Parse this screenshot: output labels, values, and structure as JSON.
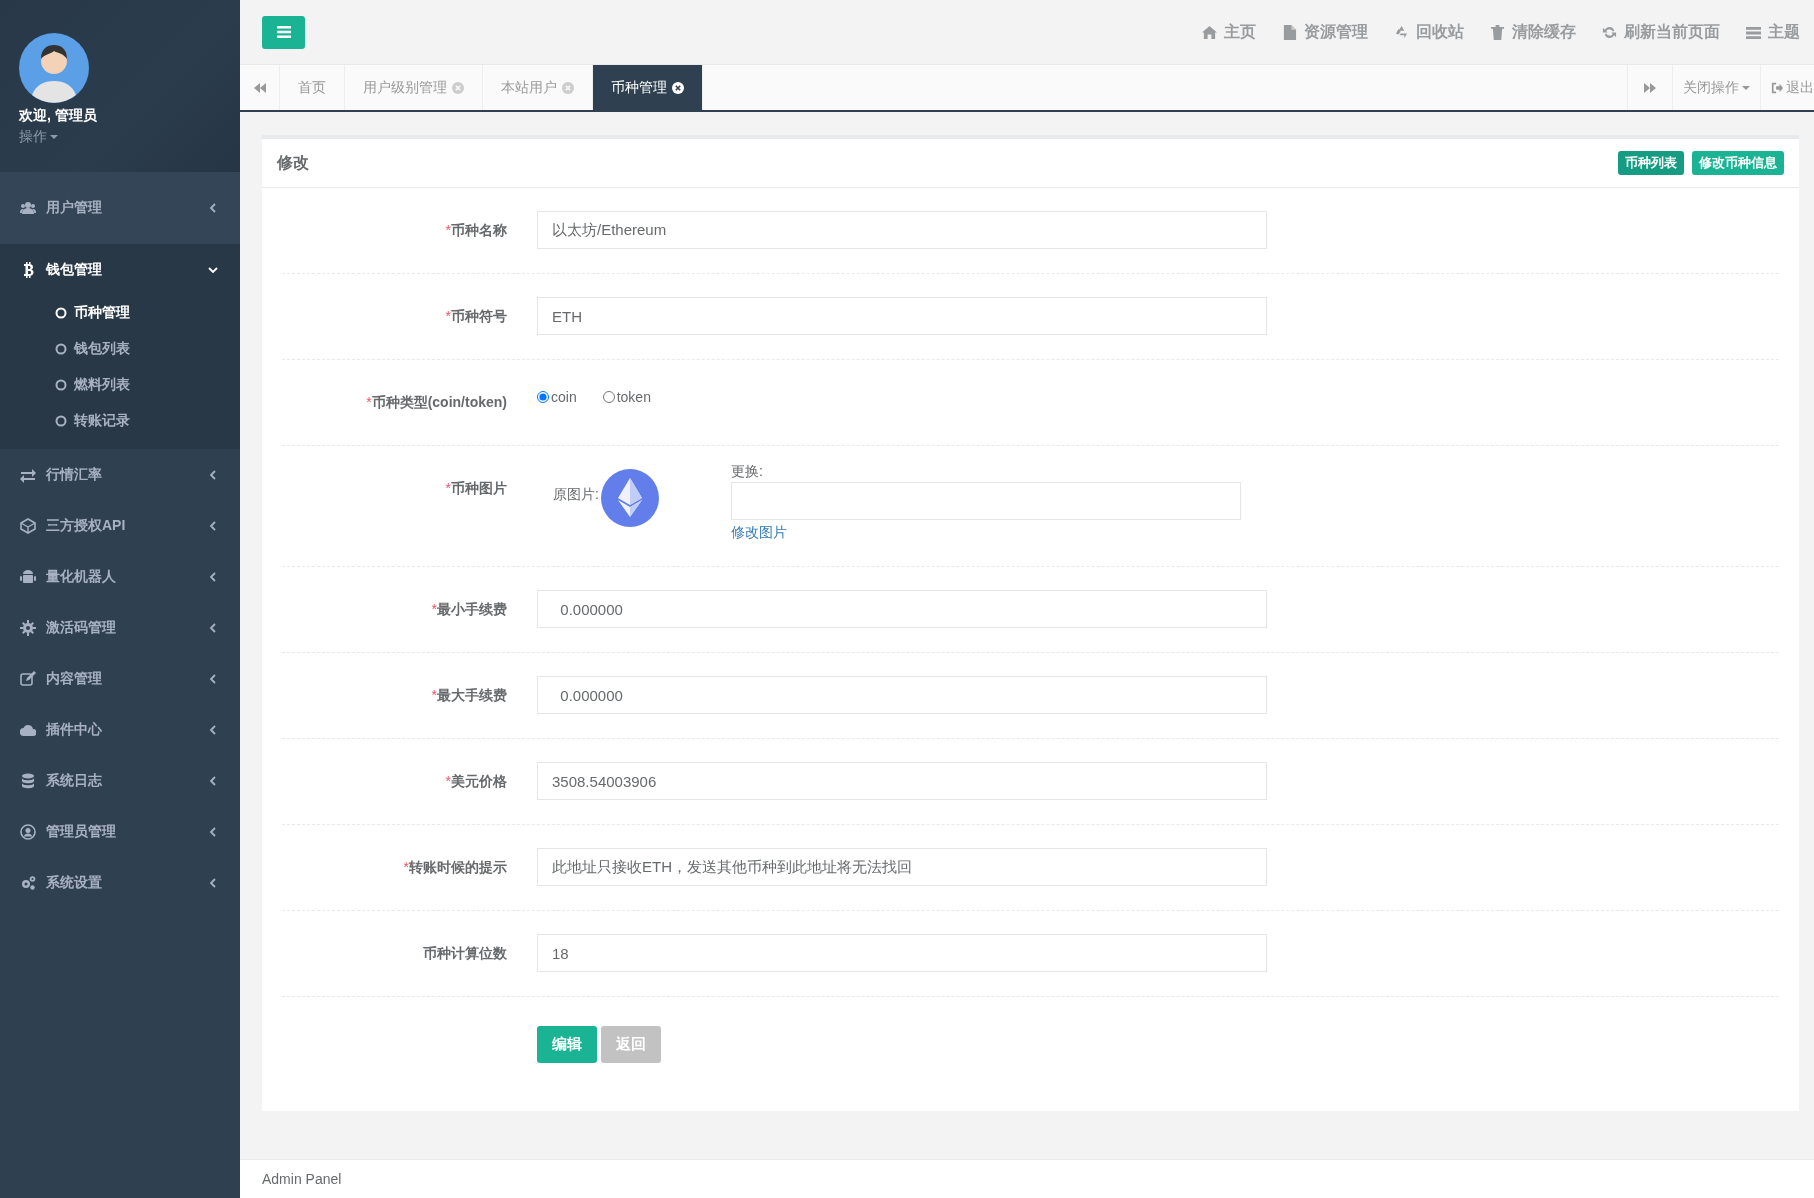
{
  "sidebar": {
    "profile": {
      "greeting": "欢迎, 管理员",
      "menu": "操作"
    },
    "items": [
      {
        "label": "用户管理",
        "highlighted": true,
        "expanded": false
      },
      {
        "label": "钱包管理",
        "highlighted": false,
        "expanded": true,
        "children": [
          {
            "label": "币种管理",
            "selected": true
          },
          {
            "label": "钱包列表",
            "selected": false
          },
          {
            "label": "燃料列表",
            "selected": false
          },
          {
            "label": "转账记录",
            "selected": false
          }
        ]
      },
      {
        "label": "行情汇率",
        "highlighted": false,
        "expanded": false
      },
      {
        "label": "三方授权API",
        "highlighted": false,
        "expanded": false
      },
      {
        "label": "量化机器人",
        "highlighted": false,
        "expanded": false
      },
      {
        "label": "激活码管理",
        "highlighted": false,
        "expanded": false
      },
      {
        "label": "内容管理",
        "highlighted": false,
        "expanded": false
      },
      {
        "label": "插件中心",
        "highlighted": false,
        "expanded": false
      },
      {
        "label": "系统日志",
        "highlighted": false,
        "expanded": false
      },
      {
        "label": "管理员管理",
        "highlighted": false,
        "expanded": false
      },
      {
        "label": "系统设置",
        "highlighted": false,
        "expanded": false
      }
    ]
  },
  "top_nav": [
    {
      "label": "主页"
    },
    {
      "label": "资源管理"
    },
    {
      "label": "回收站"
    },
    {
      "label": "清除缓存"
    },
    {
      "label": "刷新当前页面"
    },
    {
      "label": "主题"
    }
  ],
  "tabs": [
    {
      "label": "首页",
      "selected": false,
      "closable": false
    },
    {
      "label": "用户级别管理",
      "selected": false,
      "closable": true
    },
    {
      "label": "本站用户",
      "selected": false,
      "closable": true
    },
    {
      "label": "币种管理",
      "selected": true,
      "closable": true
    }
  ],
  "tab_actions": {
    "close_menu": "关闭操作",
    "logout": "退出"
  },
  "panel": {
    "title": "修改",
    "buttons": [
      {
        "label": "币种列表",
        "color": "#169c82"
      },
      {
        "label": "修改币种信息",
        "color": "#1ab394"
      }
    ],
    "fields": [
      {
        "kind": "text",
        "mark": "*",
        "label": "币种名称",
        "value": "以太坊/Ethereum"
      },
      {
        "kind": "text",
        "mark": "*",
        "label": "币种符号",
        "value": "ETH"
      },
      {
        "kind": "radio",
        "mark": "*",
        "label": "币种类型(coin/token)",
        "options": [
          {
            "label": "coin",
            "selected": true
          },
          {
            "label": "token",
            "selected": false
          }
        ]
      },
      {
        "kind": "image",
        "mark": "*",
        "label": "币种图片",
        "original_label": "原图片:",
        "replace_label": "更换:",
        "link": "修改图片"
      },
      {
        "kind": "text",
        "mark": "*",
        "label": "最小手续费",
        "value": "  0.000000"
      },
      {
        "kind": "text",
        "mark": "*",
        "label": "最大手续费",
        "value": "  0.000000"
      },
      {
        "kind": "text",
        "mark": "*",
        "label": "美元价格",
        "value": "3508.54003906"
      },
      {
        "kind": "text",
        "mark": "*",
        "label": "转账时候的提示",
        "value": "此地址只接收ETH，发送其他币种到此地址将无法找回"
      },
      {
        "kind": "text",
        "label": "币种计算位数",
        "value": "18"
      }
    ],
    "actions": [
      {
        "label": "编辑",
        "kind": "primary"
      },
      {
        "label": "返回",
        "kind": "secondary"
      }
    ]
  },
  "footer": "Admin Panel"
}
